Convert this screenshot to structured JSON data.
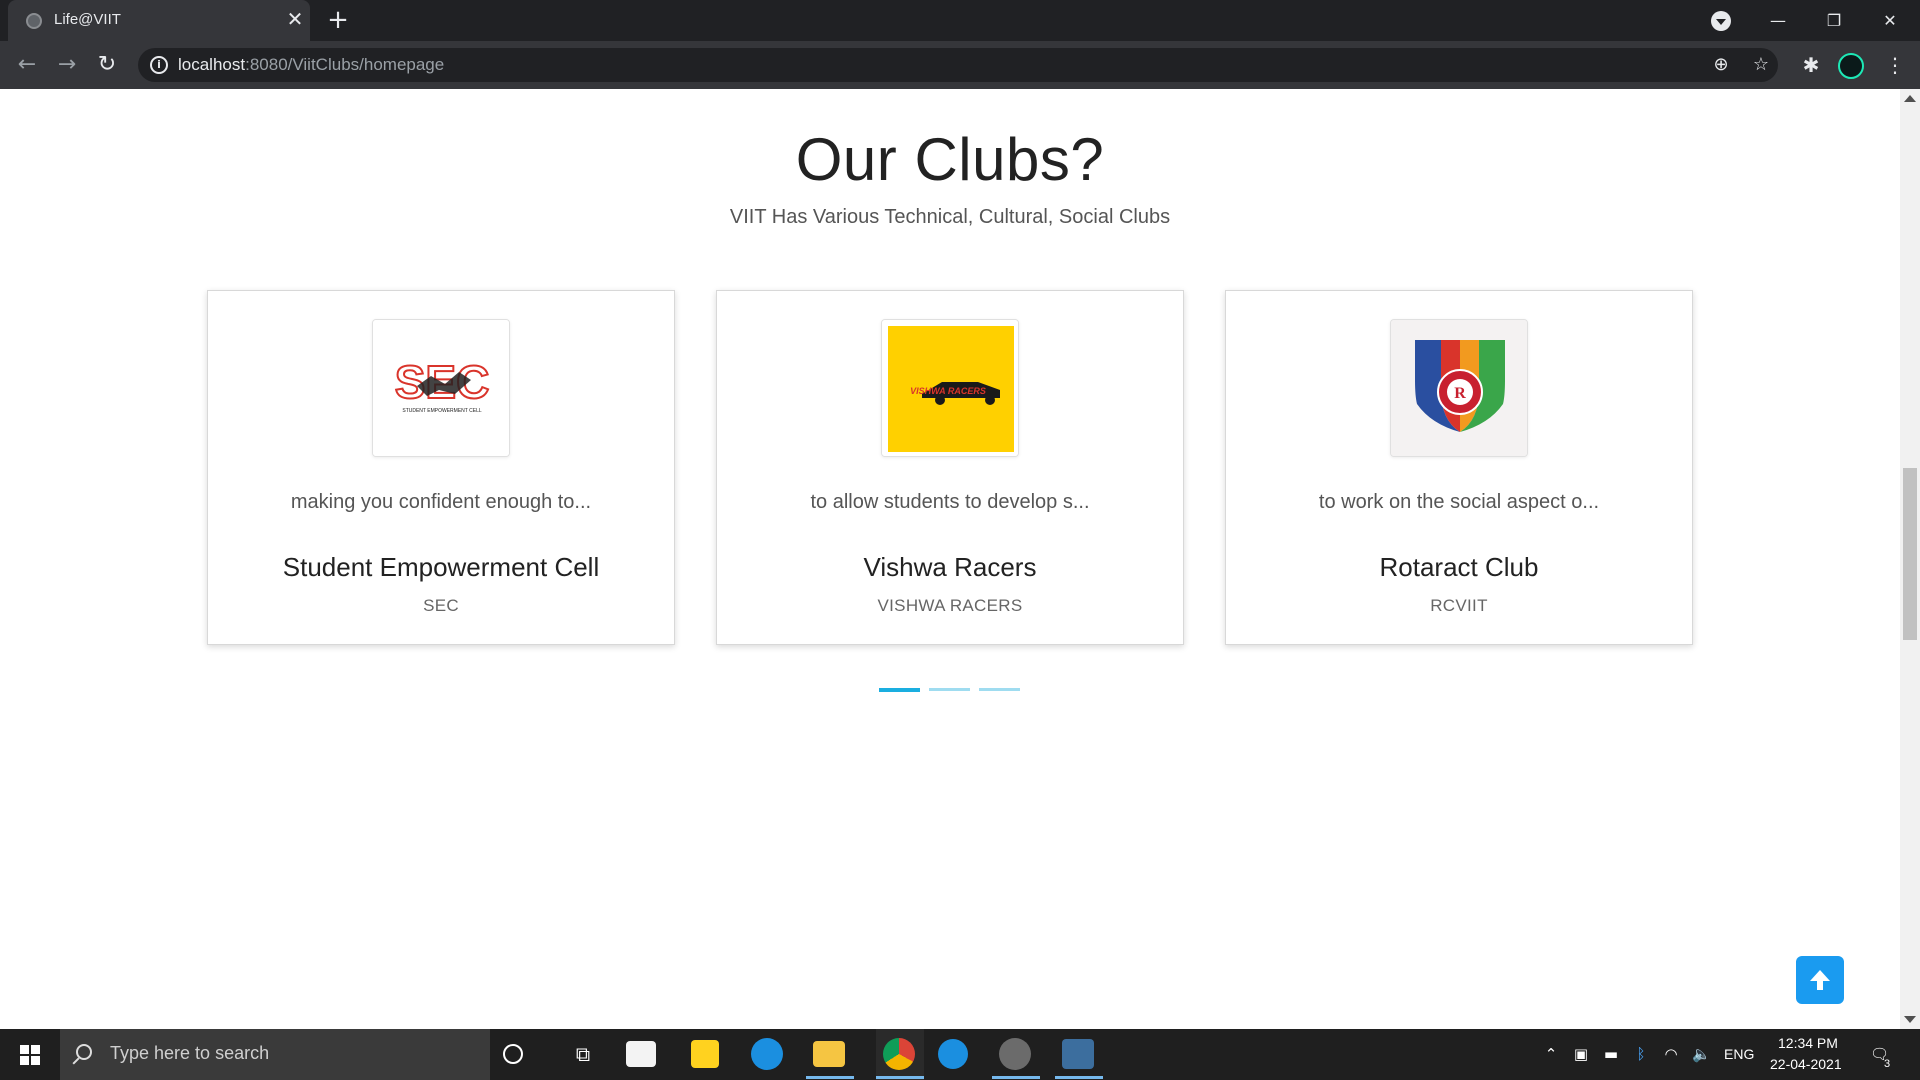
{
  "browser": {
    "tab_title": "Life@VIIT",
    "tab_close": "✕",
    "new_tab": "+",
    "url_host": "localhost",
    "url_rest": ":8080/ViitClubs/homepage"
  },
  "section": {
    "title": "Our Clubs?",
    "subtitle": "VIIT Has Various Technical, Cultural, Social Clubs"
  },
  "clubs": [
    {
      "description": "making you confident enough to...",
      "name": "Student Empowerment Cell",
      "code": "SEC",
      "logo": "sec-logo",
      "logo_text": "SEC",
      "logo_caption": "STUDENT EMPOWERMENT CELL"
    },
    {
      "description": "to allow students to develop s...",
      "name": "Vishwa Racers",
      "code": "VISHWA RACERS",
      "logo": "vishwa-racers-logo",
      "logo_text": "VISHWA RACERS"
    },
    {
      "description": "to work on the social aspect o...",
      "name": "Rotaract Club",
      "code": "RCVIIT",
      "logo": "rotaract-logo",
      "logo_text": "R"
    }
  ],
  "carousel": {
    "pages": 3,
    "active": 1
  },
  "colors": {
    "accent": "#1aaee0",
    "back_to_top": "#1a9bf0",
    "vishwa_bg": "#ffd000"
  },
  "taskbar": {
    "search_placeholder": "Type here to search",
    "time": "12:34 PM",
    "date": "22-04-2021",
    "language": "ENG",
    "notification_count": "3"
  }
}
